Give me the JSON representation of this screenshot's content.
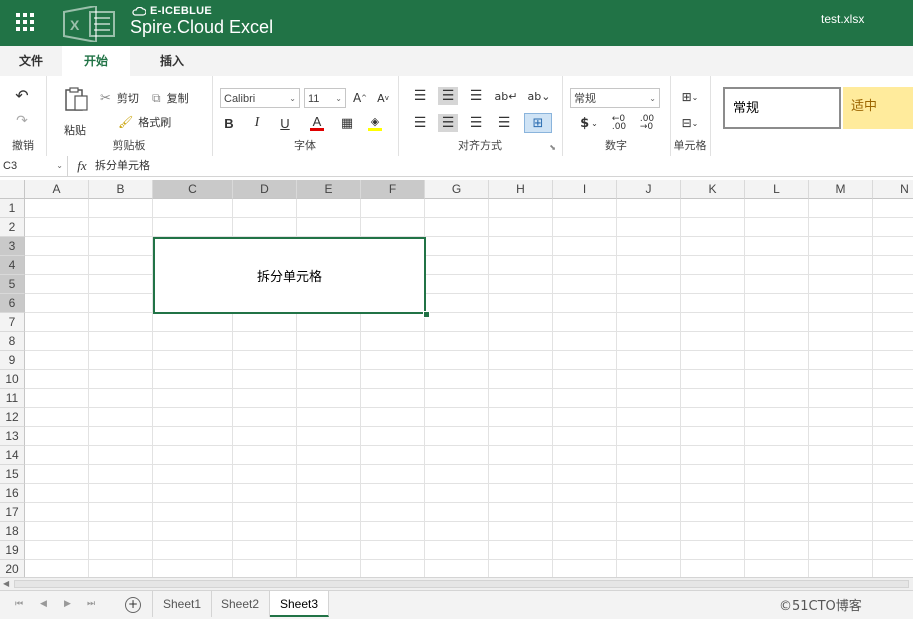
{
  "header": {
    "brand_small": "E-ICEBLUE",
    "brand_big": "Spire.Cloud Excel",
    "filename": "test.xlsx"
  },
  "tabs": [
    "文件",
    "开始",
    "插入"
  ],
  "ribbon": {
    "undo": {
      "label": "撤销"
    },
    "clipboard": {
      "paste": "粘贴",
      "cut": "剪切",
      "copy": "复制",
      "format_painter": "格式刷",
      "group": "剪贴板"
    },
    "font": {
      "family": "Calibri",
      "size": "11",
      "group": "字体",
      "bold": "B",
      "italic": "I",
      "underline": "U",
      "font_color": "A",
      "font_color_value": "#e00000",
      "fill_color_value": "#ffff00"
    },
    "alignment": {
      "group": "对齐方式"
    },
    "number": {
      "format": "常规",
      "currency": "$",
      "group": "数字"
    },
    "cells": {
      "group": "单元格"
    },
    "styles": {
      "normal": "常规",
      "neutral": "适中",
      "neutral_color": "#ffeb9c"
    }
  },
  "formula_bar": {
    "name_box": "C3",
    "fx": "fx",
    "value": "拆分单元格"
  },
  "grid": {
    "columns": [
      "A",
      "B",
      "C",
      "D",
      "E",
      "F",
      "G",
      "H",
      "I",
      "J",
      "K",
      "L",
      "M",
      "N"
    ],
    "rows": [
      "1",
      "2",
      "3",
      "4",
      "5",
      "6",
      "7",
      "8",
      "9",
      "10",
      "11",
      "12",
      "13",
      "14",
      "15",
      "16",
      "17",
      "18",
      "19",
      "20"
    ],
    "merged_cell": {
      "range": "C3:F6",
      "text": "拆分单元格"
    }
  },
  "sheets": {
    "tabs": [
      "Sheet1",
      "Sheet2",
      "Sheet3"
    ],
    "active": "Sheet3"
  },
  "watermark": "©51CTO博客",
  "colors": {
    "brand": "#217346"
  }
}
